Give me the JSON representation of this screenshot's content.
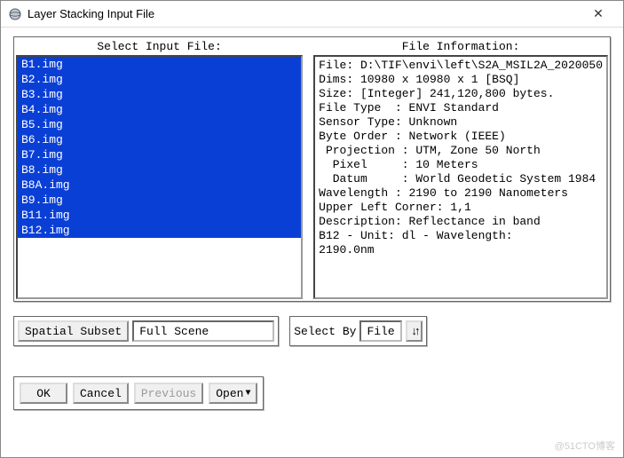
{
  "window": {
    "title": "Layer Stacking Input File",
    "close_glyph": "✕"
  },
  "panels": {
    "input_header": "Select Input File:",
    "info_header": "File Information:"
  },
  "file_list": [
    "B1.img",
    "B2.img",
    "B3.img",
    "B4.img",
    "B5.img",
    "B6.img",
    "B7.img",
    "B8.img",
    "B8A.img",
    "B9.img",
    "B11.img",
    "B12.img"
  ],
  "file_info_lines": [
    "File: D:\\TIF\\envi\\left\\S2A_MSIL2A_2020050",
    "Dims: 10980 x 10980 x 1 [BSQ]",
    "Size: [Integer] 241,120,800 bytes.",
    "File Type  : ENVI Standard",
    "Sensor Type: Unknown",
    "Byte Order : Network (IEEE)",
    " Projection : UTM, Zone 50 North",
    "  Pixel     : 10 Meters",
    "  Datum     : World Geodetic System 1984",
    "Wavelength : 2190 to 2190 Nanometers",
    "Upper Left Corner: 1,1",
    "Description: Reflectance in band",
    "B12 - Unit: dl - Wavelength:",
    "2190.0nm"
  ],
  "spatial_subset": {
    "button": "Spatial Subset",
    "value": "Full Scene"
  },
  "select_by": {
    "label": "Select By",
    "value": "File"
  },
  "buttons": {
    "ok": "OK",
    "cancel": "Cancel",
    "previous": "Previous",
    "open": "Open"
  },
  "watermark": "@51CTO博客"
}
